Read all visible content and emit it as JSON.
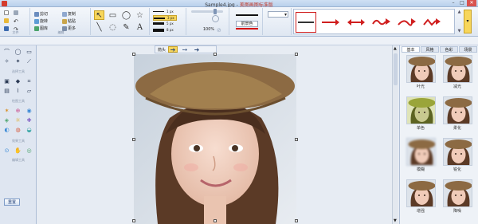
{
  "window": {
    "file_title": "Sample4.jpg",
    "app_title": "美图画图标准版"
  },
  "window_controls": {
    "minimize": "–",
    "maximize": "□",
    "close": "✕"
  },
  "ribbon": {
    "file_group": {
      "label": "文件"
    },
    "edit_group": {
      "label": "编辑",
      "buttons": [
        "剪切",
        "复制",
        "旋转",
        "粘贴",
        "图库",
        "更多"
      ]
    },
    "shapes_group": {
      "label": "形状"
    },
    "line_sizes": {
      "label": "线型",
      "items": [
        "1 px",
        "3 px",
        "5 px",
        "8 px"
      ],
      "selected_index": 1,
      "opacity_value": "100%"
    },
    "color": {
      "name": "前景色",
      "value": "#d40000"
    },
    "arrows": {
      "label": "箭头"
    }
  },
  "left_tools": {
    "sections": [
      "选择工具",
      "绘图工具",
      "效果工具",
      "编辑工具"
    ],
    "bottom_button": "重置"
  },
  "canvas": {
    "floatbar": {
      "label": "箭头"
    }
  },
  "right_panel": {
    "tabs": [
      "基本",
      "风格",
      "色彩",
      "场景"
    ],
    "active_tab": 0,
    "effects": [
      "叶光",
      "减光",
      "单色",
      "柔化",
      "模糊",
      "锐化",
      "增强",
      "降噪"
    ]
  },
  "colors": {
    "accent_yellow": "#f7d65b",
    "arrow_red": "#d01e1e",
    "ribbon_bg": "#e6edf6",
    "title_red": "#c0392b"
  }
}
